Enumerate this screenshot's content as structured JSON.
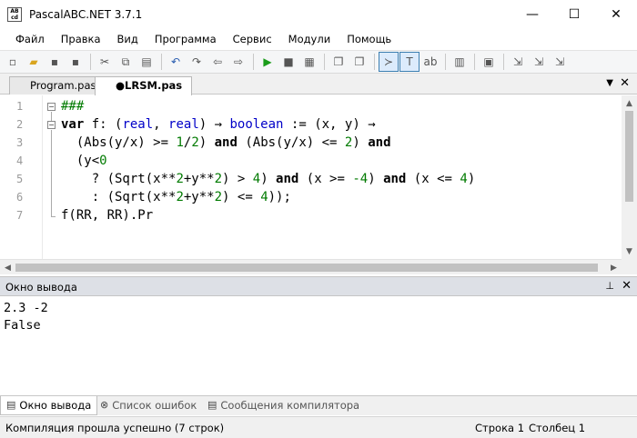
{
  "window": {
    "icon_text": "AB cd",
    "title": "PascalABC.NET 3.7.1",
    "minimize": "—",
    "maximize": "☐",
    "close": "✕"
  },
  "menu": [
    "Файл",
    "Правка",
    "Вид",
    "Программа",
    "Сервис",
    "Модули",
    "Помощь"
  ],
  "toolbar": {
    "icons": [
      "new-file-icon",
      "open-folder-icon",
      "save-icon",
      "save-all-icon",
      "cut-icon",
      "copy-icon",
      "paste-icon",
      "undo-icon",
      "redo-icon",
      "navigate-back-icon",
      "navigate-forward-icon",
      "run-icon",
      "stop-icon",
      "compile-icon",
      "comment-icon",
      "uncomment-icon",
      "console-icon",
      "text-icon",
      "format-icon",
      "debug-icon",
      "code-icon",
      "debug-step-icon",
      "debug-into-icon",
      "debug-out-icon"
    ],
    "glyphs": [
      "▫",
      "▰",
      "▪",
      "▪",
      "✂",
      "⧉",
      "▤",
      "↶",
      "↷",
      "⇦",
      "⇨",
      "▶",
      "■",
      "▦",
      "❐",
      "❐",
      "≻",
      "T",
      "ab",
      "▥",
      "▣",
      "⇲",
      "⇲",
      "⇲"
    ]
  },
  "tabs": [
    {
      "label": "Program.pas",
      "active": false
    },
    {
      "label": "●LRSM.pas",
      "active": true
    }
  ],
  "tab_dropdown": "▼",
  "tab_close": "✕",
  "editor": {
    "line_numbers": [
      "1",
      "2",
      "3",
      "4",
      "5",
      "6",
      "7"
    ],
    "fold_minus": "−",
    "line1": "###",
    "line2": {
      "kw": "var",
      "p1": " f: (",
      "t1": "real",
      "p2": ", ",
      "t2": "real",
      "p3": ") → ",
      "t3": "boolean",
      "p4": " := (x, y) →"
    },
    "line3": {
      "p1": "  (Abs(y/x) >= ",
      "n1": "1",
      "p2": "/",
      "n2": "2",
      "p3": ") ",
      "k1": "and",
      "p4": " (Abs(y/x) <= ",
      "n3": "2",
      "p5": ") ",
      "k2": "and"
    },
    "line4": {
      "p1": "  (y<",
      "n1": "0"
    },
    "line5": {
      "p1": "    ? (Sqrt(x**",
      "n1": "2",
      "p2": "+y**",
      "n2": "2",
      "p3": ") > ",
      "n3": "4",
      "p4": ") ",
      "k1": "and",
      "p5": " (x >= ",
      "n4": "-4",
      "p6": ") ",
      "k2": "and",
      "p7": " (x <= ",
      "n5": "4",
      "p8": ")"
    },
    "line6": {
      "p1": "    : (Sqrt(x**",
      "n1": "2",
      "p2": "+y**",
      "n2": "2",
      "p3": ") <= ",
      "n3": "4",
      "p4": "));"
    },
    "line7": "f(RR, RR).Pr"
  },
  "scroll": {
    "up": "▲",
    "down": "▼",
    "left": "◀",
    "right": "▶"
  },
  "output_panel": {
    "title": "Окно вывода",
    "pin": "⊥",
    "close": "✕",
    "lines": [
      "2.3 -2",
      "False"
    ]
  },
  "bottom_tabs": [
    {
      "label": "Окно вывода",
      "icon": "▤"
    },
    {
      "label": "Список ошибок",
      "icon": "⊗"
    },
    {
      "label": "Сообщения компилятора",
      "icon": "▤"
    }
  ],
  "status": {
    "message": "Компиляция прошла успешно (7 строк)",
    "row_label": "Строка  1",
    "col_label": "Столбец  1"
  }
}
